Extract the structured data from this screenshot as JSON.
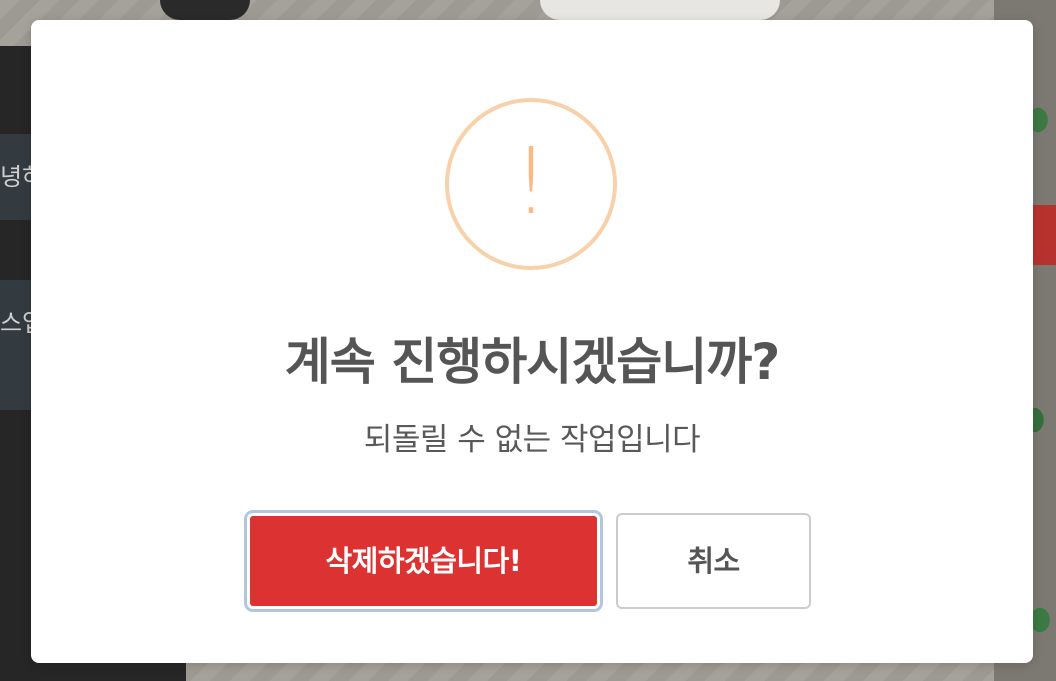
{
  "background": {
    "sidebar_items": [
      "녕하",
      "스업"
    ]
  },
  "dialog": {
    "icon": "exclamation-circle-icon",
    "icon_glyph": "!",
    "icon_color": "#f8bb86",
    "title": "계속 진행하시겠습니까?",
    "text": "되돌릴 수 없는 작업입니다",
    "confirm_label": "삭제하겠습니다!",
    "confirm_color": "#dd3232",
    "cancel_label": "취소"
  }
}
